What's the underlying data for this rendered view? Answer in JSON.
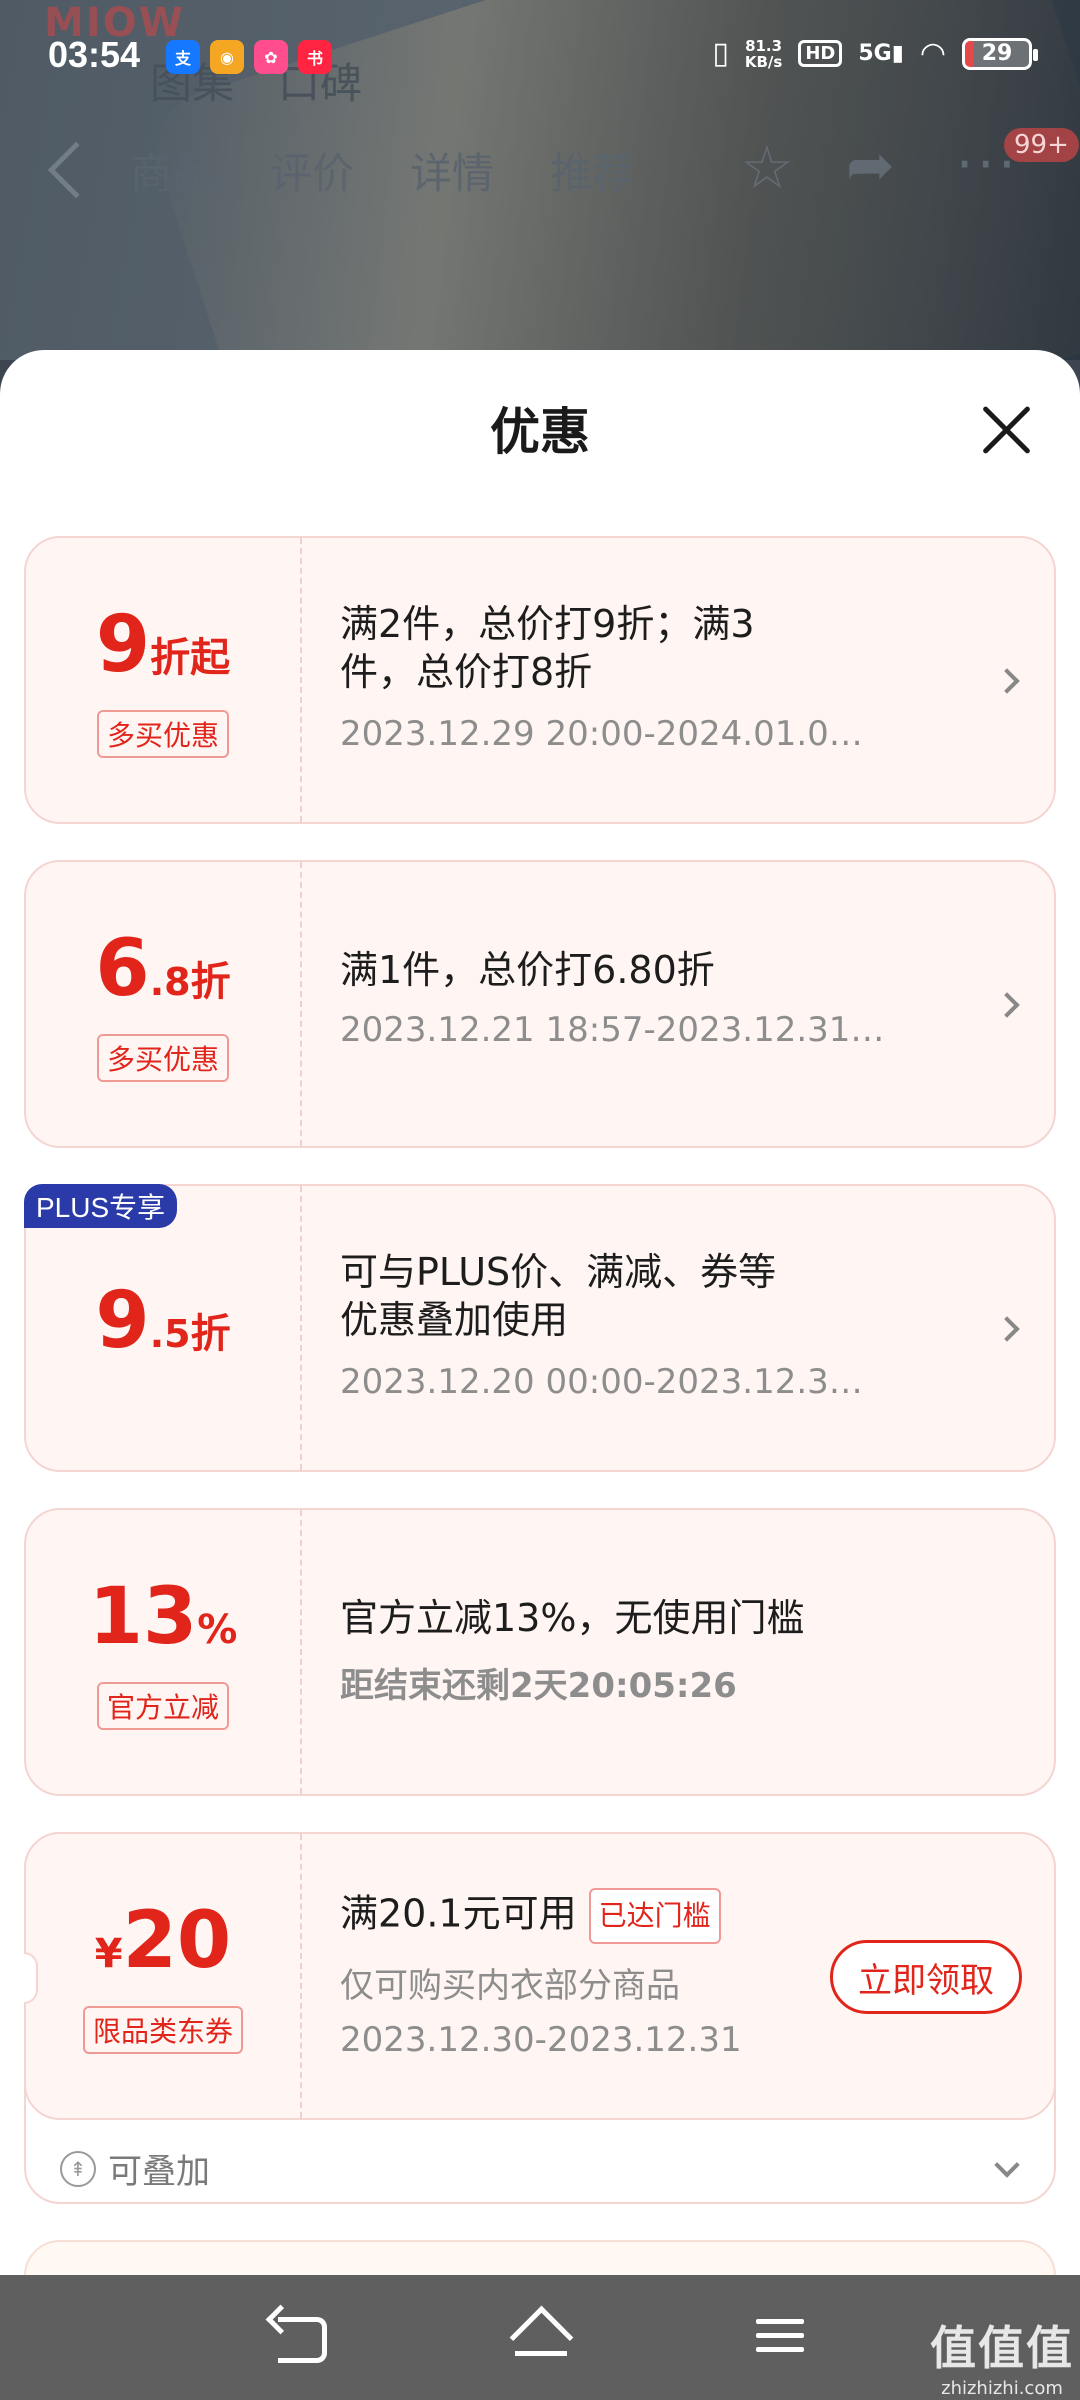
{
  "status_bar": {
    "time": "03:54",
    "net_speed_value": "81.3",
    "net_speed_unit": "KB/s",
    "hd": "HD",
    "signal": "5G",
    "battery": "29"
  },
  "background_page": {
    "logo": "MIOW",
    "tags": [
      "图集",
      "口碑"
    ],
    "tabs": [
      "商品",
      "评价",
      "详情",
      "推荐"
    ],
    "badge": "99+"
  },
  "sheet": {
    "title": "优惠"
  },
  "offers": [
    {
      "value_main": "9",
      "value_small": "",
      "value_unit": "折起",
      "tag": "多买优惠",
      "plus_badge": "",
      "desc_line1": "满2件，总价打9折；满3",
      "desc_line2": "件，总价打8折",
      "time": "2023.12.29 20:00-2024.01.0…"
    },
    {
      "value_main": "6",
      "value_small": ".8",
      "value_unit": "折",
      "tag": "多买优惠",
      "plus_badge": "",
      "desc_line1": "满1件，总价打6.80折",
      "desc_line2": "",
      "time": "2023.12.21 18:57-2023.12.31…"
    },
    {
      "value_main": "9",
      "value_small": ".5",
      "value_unit": "折",
      "tag": "",
      "plus_badge": "PLUS专享",
      "desc_line1": "可与PLUS价、满减、券等",
      "desc_line2": "优惠叠加使用",
      "time": "2023.12.20 00:00-2023.12.3…"
    },
    {
      "value_main": "13",
      "value_small": "",
      "value_unit": "%",
      "tag": "官方立减",
      "plus_badge": "",
      "desc_line1": "官方立减13%，无使用门槛",
      "desc_line2": "",
      "time": "距结束还剩2天20:05:26"
    }
  ],
  "coupon": {
    "currency": "¥",
    "amount": "20",
    "tag": "限品类东券",
    "condition": "满20.1元可用",
    "reached_badge": "已达门槛",
    "scope": "仅可购买内衣部分商品",
    "time": "2023.12.30-2023.12.31",
    "claim_label": "立即领取",
    "stackable_label": "可叠加"
  },
  "watermark": {
    "big": "值值值",
    "small": "zhizhizhi.com"
  },
  "colors": {
    "accent": "#e1251b",
    "card_bg": "#fff6f4",
    "card_border": "#f4d5d2",
    "plus_blue": "#2a3aa9",
    "nav_bar": "#5f5f5f"
  },
  "icons": {
    "close": "close-icon",
    "chevron": "chevron-right-icon",
    "stack": "stack-icon",
    "expand": "chevron-down-icon"
  }
}
